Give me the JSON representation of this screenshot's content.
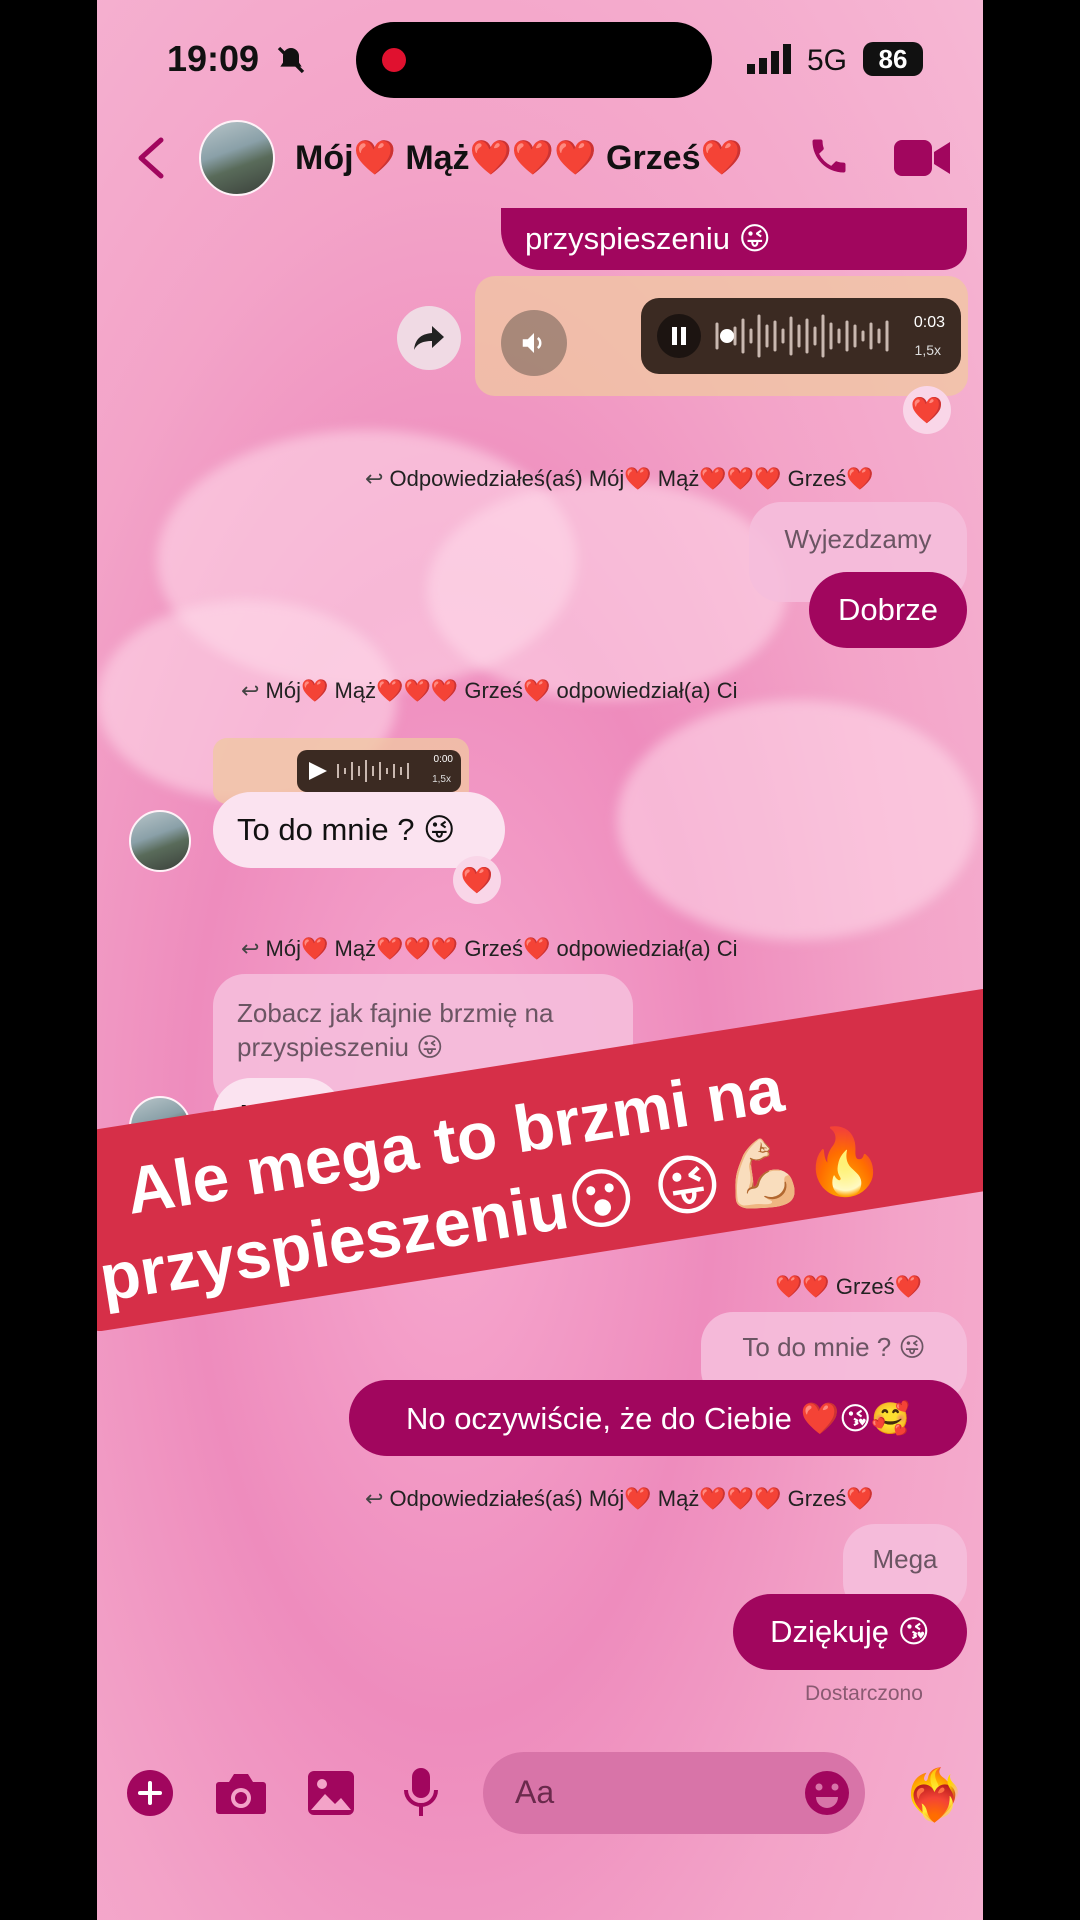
{
  "status_bar": {
    "time": "19:09",
    "network": "5G",
    "battery": "86"
  },
  "header": {
    "contact_name": "Mój❤️ Mąż❤️❤️❤️ Grześ❤️"
  },
  "messages": {
    "top_out_text": "przyspieszeniu 😜",
    "voice": {
      "duration": "0:03",
      "speed": "1,5x"
    },
    "voice_small": {
      "duration": "0:00",
      "speed": "1,5x"
    },
    "reply1_meta": "Odpowiedziałeś(aś) Mój❤️ Mąż❤️❤️❤️ Grześ❤️",
    "reply1_quote": "Wyjezdzamy",
    "reply1_text": "Dobrze",
    "reply2_meta": "Mój❤️ Mąż❤️❤️❤️ Grześ❤️ odpowiedział(a) Ci",
    "reply2_text": "To do mnie ? 😜",
    "reply3_meta": "Mój❤️ Mąż❤️❤️❤️ Grześ❤️ odpowiedział(a) Ci",
    "reply3_quote": "Zobacz jak fajnie brzmię na przyspieszeniu 😜",
    "reply3_text": "Mega",
    "reply4_meta_partial": "❤️❤️ Grześ❤️",
    "reply4_quote": "To do mnie ? 😜",
    "reply4_text": "No oczywiście, że do Ciebie ❤️😘🥰",
    "reply5_meta": "Odpowiedziałeś(aś) Mój❤️ Mąż❤️❤️❤️ Grześ❤️",
    "reply5_quote": "Mega",
    "reply5_text": "Dziękuję 😘",
    "delivered": "Dostarczono"
  },
  "composer": {
    "placeholder": "Aa"
  },
  "overlay": {
    "line1": "Ale mega to brzmi na",
    "line2": "przyspieszeniu😮 😜💪🏻🔥"
  },
  "colors": {
    "accent": "#a1065e",
    "banner": "#d62f48"
  }
}
